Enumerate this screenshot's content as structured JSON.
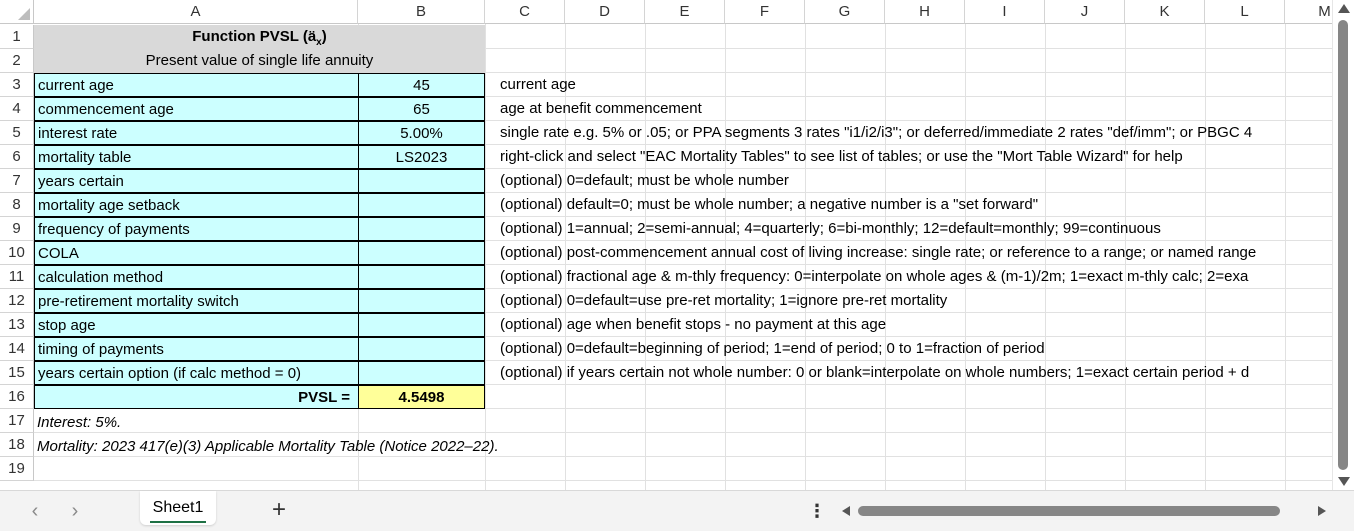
{
  "columns": [
    "A",
    "B",
    "C",
    "D",
    "E",
    "F",
    "G",
    "H",
    "I",
    "J",
    "K",
    "L",
    "M"
  ],
  "rows": [
    "1",
    "2",
    "3",
    "4",
    "5",
    "6",
    "7",
    "8",
    "9",
    "10",
    "11",
    "12",
    "13",
    "14",
    "15",
    "16",
    "17",
    "18",
    "19"
  ],
  "title": {
    "prefix": "Function PVSL (ä",
    "subscript": "x",
    "suffix": ")",
    "subtitle": "Present value of single life annuity"
  },
  "parameters": [
    {
      "label": "current age",
      "value": "45",
      "description": "current age"
    },
    {
      "label": "commencement age",
      "value": "65",
      "description": "age at benefit commencement"
    },
    {
      "label": "interest rate",
      "value": "5.00%",
      "description": "single rate e.g. 5% or .05; or PPA segments 3 rates \"i1/i2/i3\"; or deferred/immediate 2 rates \"def/imm\"; or PBGC 4"
    },
    {
      "label": "mortality table",
      "value": "LS2023",
      "description": "right-click and select \"EAC Mortality Tables\" to see list of tables; or use the \"Mort Table Wizard\" for help"
    },
    {
      "label": "years certain",
      "value": "",
      "description": "(optional) 0=default; must be whole number"
    },
    {
      "label": "mortality age setback",
      "value": "",
      "description": "(optional) default=0; must be whole number; a negative number is a \"set forward\""
    },
    {
      "label": "frequency of payments",
      "value": "",
      "description": "(optional) 1=annual; 2=semi-annual; 4=quarterly; 6=bi-monthly; 12=default=monthly; 99=continuous"
    },
    {
      "label": "COLA",
      "value": "",
      "description": "(optional) post-commencement annual cost of living increase: single rate; or reference to a range; or named range"
    },
    {
      "label": "calculation method",
      "value": "",
      "description": "(optional) fractional age & m-thly frequency: 0=interpolate on whole ages & (m-1)/2m; 1=exact m-thly calc; 2=exa"
    },
    {
      "label": "pre-retirement mortality switch",
      "value": "",
      "description": "(optional) 0=default=use pre-ret mortality; 1=ignore pre-ret mortality"
    },
    {
      "label": "stop age",
      "value": "",
      "description": "(optional) age when benefit stops - no payment at this age"
    },
    {
      "label": "timing of payments",
      "value": "",
      "description": "(optional) 0=default=beginning of period; 1=end of period; 0 to 1=fraction of period"
    },
    {
      "label": "years certain option (if calc method = 0)",
      "value": "",
      "description": "(optional) if years certain not whole number: 0 or blank=interpolate on whole numbers; 1=exact certain period + d"
    }
  ],
  "result": {
    "label": "PVSL =",
    "value": "4.5498"
  },
  "notes": [
    "Interest:  5%.",
    "Mortality:  2023 417(e)(3) Applicable Mortality Table (Notice 2022–22)."
  ],
  "sheet_tabs": [
    "Sheet1"
  ],
  "colors": {
    "input_fill": "#ccffff",
    "title_fill": "#d9d9d9",
    "result_fill": "#ffff99",
    "tab_accent": "#1e7145"
  }
}
